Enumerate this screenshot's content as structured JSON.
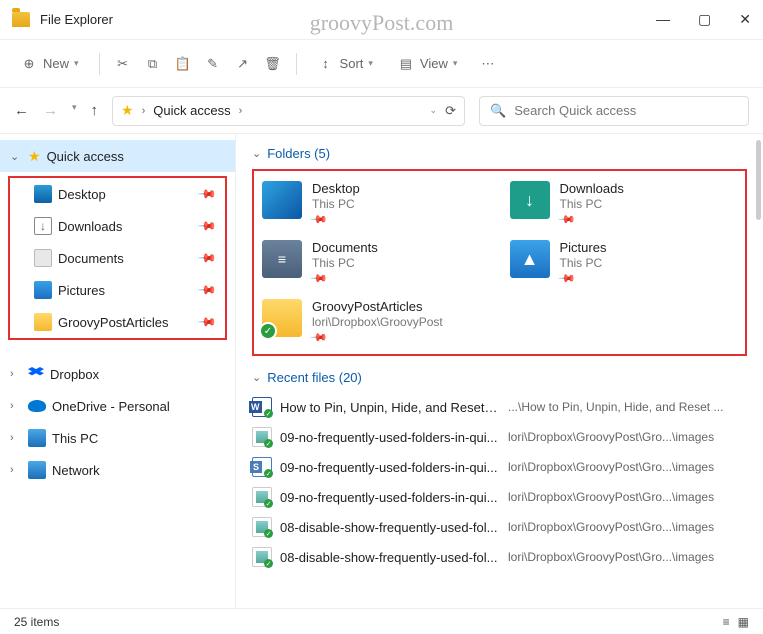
{
  "window": {
    "title": "File Explorer",
    "watermark": "groovyPost.com"
  },
  "toolbar": {
    "new": "New",
    "sort": "Sort",
    "view": "View"
  },
  "address": {
    "location": "Quick access",
    "search_placeholder": "Search Quick access"
  },
  "sidebar": {
    "quick_access": "Quick access",
    "items": [
      {
        "label": "Desktop",
        "icon": "desktop"
      },
      {
        "label": "Downloads",
        "icon": "download"
      },
      {
        "label": "Documents",
        "icon": "documents"
      },
      {
        "label": "Pictures",
        "icon": "pictures"
      },
      {
        "label": "GroovyPostArticles",
        "icon": "folder"
      }
    ],
    "roots": [
      {
        "label": "Dropbox",
        "icon": "dropbox"
      },
      {
        "label": "OneDrive - Personal",
        "icon": "onedrive"
      },
      {
        "label": "This PC",
        "icon": "thispc"
      },
      {
        "label": "Network",
        "icon": "network"
      }
    ]
  },
  "sections": {
    "folders_header": "Folders (5)",
    "recent_header": "Recent files (20)"
  },
  "folders": [
    {
      "name": "Desktop",
      "loc": "This PC",
      "icon": "desktop"
    },
    {
      "name": "Downloads",
      "loc": "This PC",
      "icon": "downloads"
    },
    {
      "name": "Documents",
      "loc": "This PC",
      "icon": "documents"
    },
    {
      "name": "Pictures",
      "loc": "This PC",
      "icon": "pictures"
    },
    {
      "name": "GroovyPostArticles",
      "loc": "lori\\Dropbox\\GroovyPost",
      "icon": "gp"
    }
  ],
  "recent": [
    {
      "name": "How to Pin, Unpin, Hide, and Reset Q...",
      "path": "...\\How to Pin, Unpin, Hide, and Reset ...",
      "type": "word"
    },
    {
      "name": "09-no-frequently-used-folders-in-qui...",
      "path": "lori\\Dropbox\\GroovyPost\\Gro...\\images",
      "type": "img"
    },
    {
      "name": "09-no-frequently-used-folders-in-qui...",
      "path": "lori\\Dropbox\\GroovyPost\\Gro...\\images",
      "type": "snag"
    },
    {
      "name": "09-no-frequently-used-folders-in-qui...",
      "path": "lori\\Dropbox\\GroovyPost\\Gro...\\images",
      "type": "img"
    },
    {
      "name": "08-disable-show-frequently-used-fol...",
      "path": "lori\\Dropbox\\GroovyPost\\Gro...\\images",
      "type": "img"
    },
    {
      "name": "08-disable-show-frequently-used-fol...",
      "path": "lori\\Dropbox\\GroovyPost\\Gro...\\images",
      "type": "img"
    }
  ],
  "status": {
    "count": "25 items"
  }
}
